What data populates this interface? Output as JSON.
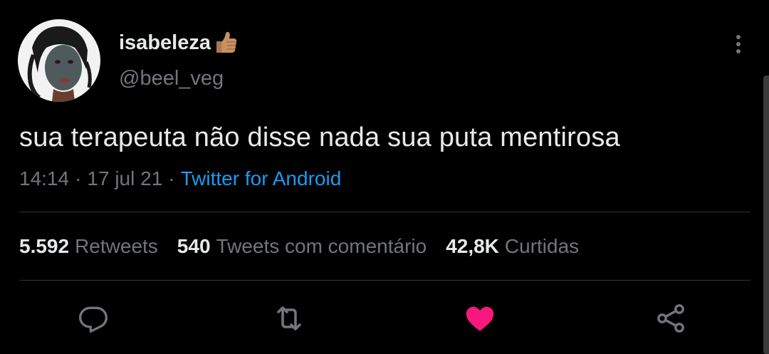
{
  "author": {
    "display_name": "isabeleza",
    "badge_emoji": "thumbs-up-icon",
    "handle": "@beel_veg"
  },
  "tweet": {
    "text": "sua terapeuta não disse nada sua puta mentirosa",
    "time": "14:14",
    "separator": "·",
    "date": "17 jul 21",
    "source": "Twitter for Android"
  },
  "stats": {
    "retweets_count": "5.592",
    "retweets_label": "Retweets",
    "quotes_count": "540",
    "quotes_label": "Tweets com comentário",
    "likes_count": "42,8K",
    "likes_label": "Curtidas"
  },
  "actions": [
    {
      "name": "reply",
      "icon": "reply-icon"
    },
    {
      "name": "retweet",
      "icon": "retweet-icon"
    },
    {
      "name": "like",
      "icon": "heart-icon",
      "active": true
    },
    {
      "name": "share",
      "icon": "share-icon"
    }
  ],
  "colors": {
    "background": "#000000",
    "primary_text": "#e7e9ea",
    "secondary_text": "#71767b",
    "link": "#1d9bf0",
    "like_active": "#f91880",
    "divider": "#2f3336"
  }
}
